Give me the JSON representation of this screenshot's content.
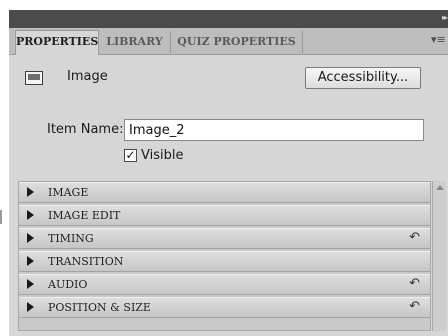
{
  "header": {
    "collapse_glyph": "▸▸",
    "panel_menu_icon": "panel-menu-icon"
  },
  "tabs": [
    {
      "label": "PROPERTIES",
      "active": true
    },
    {
      "label": "LIBRARY",
      "active": false
    },
    {
      "label": "QUIZ PROPERTIES",
      "active": false
    }
  ],
  "object": {
    "type_icon": "image-icon",
    "type_label": "Image",
    "accessibility_button": "Accessibility..."
  },
  "item_name": {
    "label": "Item Name:",
    "value": "Image_2"
  },
  "visible": {
    "label": "Visible",
    "checked": true,
    "check_glyph": "✓"
  },
  "sections": [
    {
      "label": "IMAGE",
      "has_reset": false
    },
    {
      "label": "IMAGE EDIT",
      "has_reset": false
    },
    {
      "label": "TIMING",
      "has_reset": true
    },
    {
      "label": "TRANSITION",
      "has_reset": false
    },
    {
      "label": "AUDIO",
      "has_reset": true
    },
    {
      "label": "POSITION & SIZE",
      "has_reset": true
    }
  ],
  "reset_glyph": "↶",
  "colors": {
    "titlebar": "#4b4b4b",
    "panel": "#d6d6d6",
    "tabrow": "#bdbdbd"
  }
}
